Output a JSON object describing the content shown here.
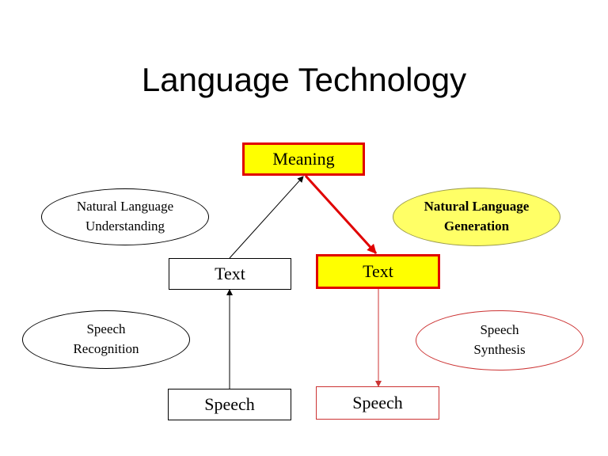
{
  "slide": {
    "title": "Language Technology"
  },
  "nodes": {
    "meaning": "Meaning",
    "text_left": "Text",
    "text_right": "Text",
    "speech_left": "Speech",
    "speech_right": "Speech"
  },
  "labels": {
    "nlu": [
      "Natural Language",
      "Understanding"
    ],
    "nlg": [
      "Natural Language",
      "Generation"
    ],
    "speech_recognition": [
      "Speech",
      "Recognition"
    ],
    "speech_synthesis": [
      "Speech",
      "Synthesis"
    ]
  },
  "colors": {
    "highlight_fill": "#ffff00",
    "highlight_border": "#e00000",
    "accent_red": "#cc3333",
    "label_fill_yellow": "#ffff66"
  }
}
